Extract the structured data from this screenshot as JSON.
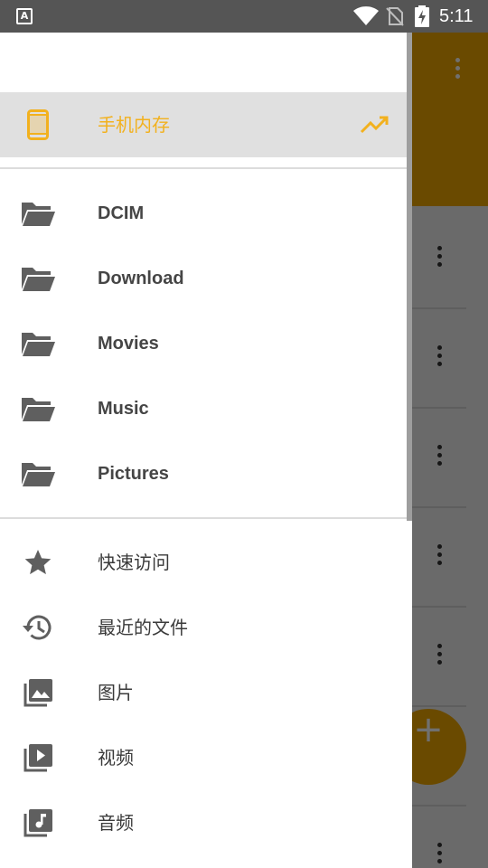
{
  "status_bar": {
    "indicator_letter": "A",
    "time": "5:11",
    "icons": [
      "text-a-icon",
      "wifi-icon",
      "no-sim-icon",
      "battery-charging-icon"
    ]
  },
  "colors": {
    "accent": "#f2a900",
    "storage_label": "#f2b11e",
    "icon_gray": "#666666",
    "selected_bg": "#e0e0e0"
  },
  "drawer": {
    "storage": {
      "label": "手机内存",
      "icon": "phone-icon",
      "action_icon": "trending-up-icon"
    },
    "folders": [
      {
        "label": "DCIM",
        "icon": "folder-open-icon"
      },
      {
        "label": "Download",
        "icon": "folder-open-icon"
      },
      {
        "label": "Movies",
        "icon": "folder-open-icon"
      },
      {
        "label": "Music",
        "icon": "folder-open-icon"
      },
      {
        "label": "Pictures",
        "icon": "folder-open-icon"
      }
    ],
    "quick": [
      {
        "label": "快速访问",
        "icon": "star-icon"
      },
      {
        "label": "最近的文件",
        "icon": "history-icon"
      },
      {
        "label": "图片",
        "icon": "photo-library-icon"
      },
      {
        "label": "视频",
        "icon": "video-library-icon"
      },
      {
        "label": "音频",
        "icon": "music-library-icon"
      }
    ]
  },
  "background": {
    "fab_icon": "add-icon",
    "fab_symbol": "+",
    "overflow_icon": "more-vert-icon"
  }
}
